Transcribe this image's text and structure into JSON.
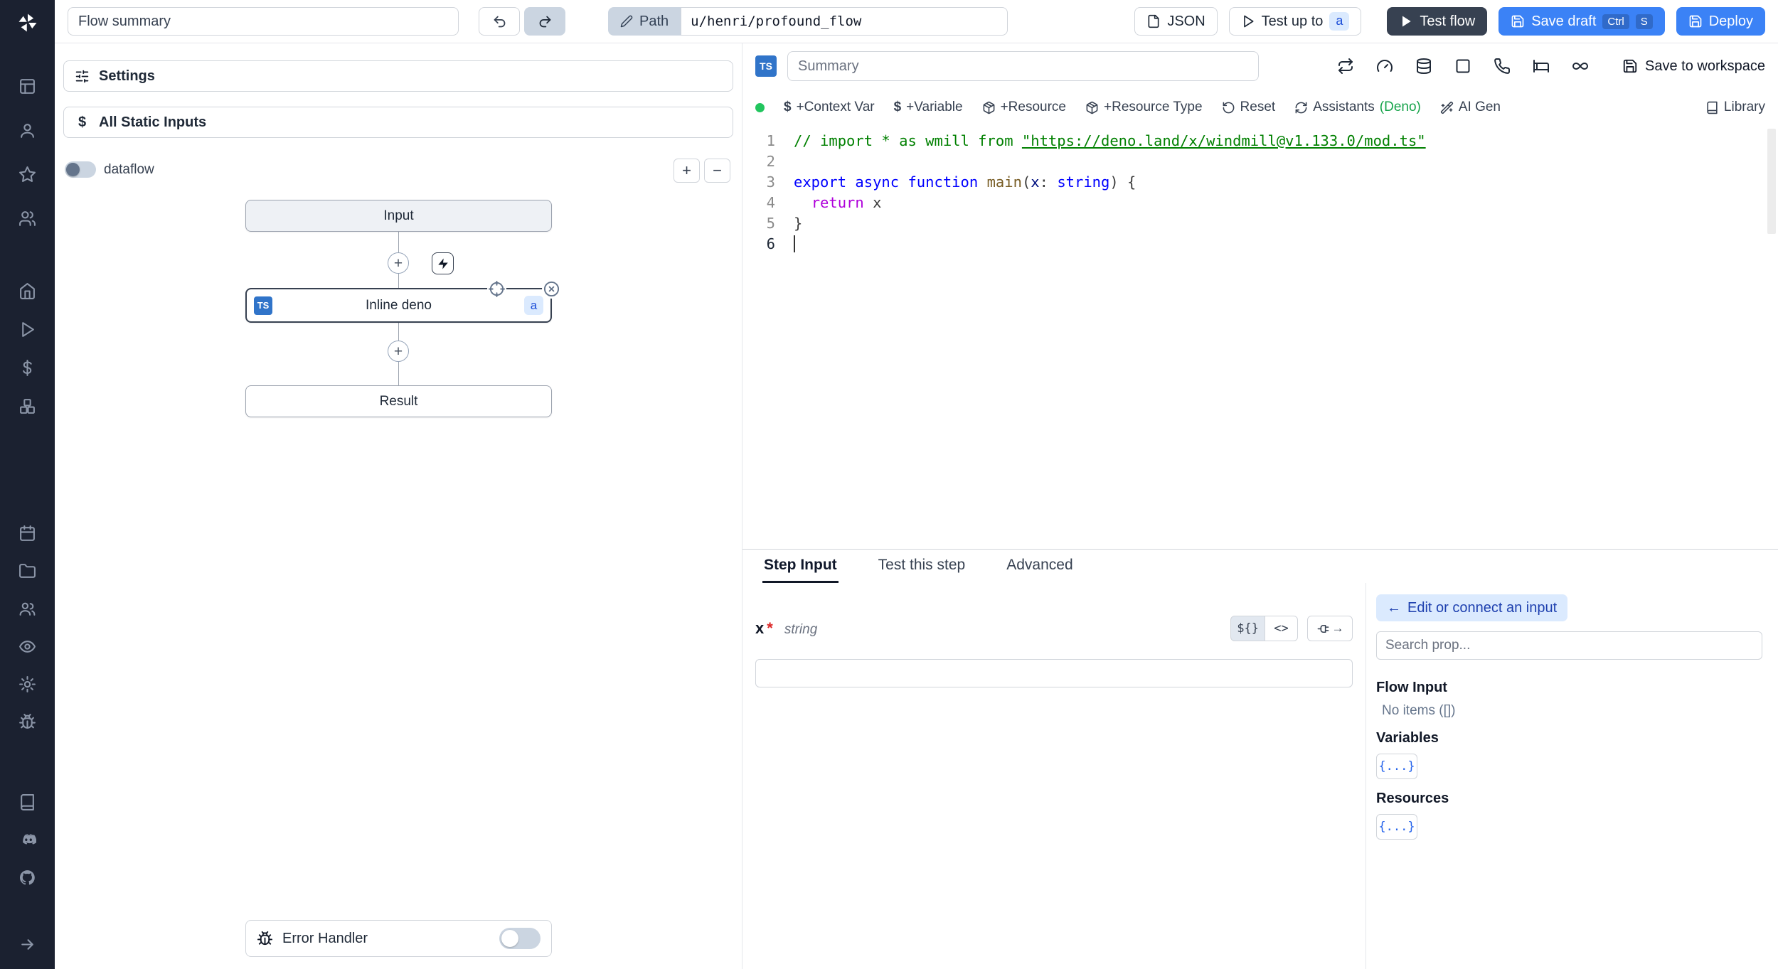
{
  "colors": {
    "sidebar_bg": "#1b2130",
    "accent_blue": "#3b82f6",
    "dark_button": "#374151",
    "status_green": "#22c55e",
    "badge_bg": "#dbeafe",
    "badge_text": "#1d4ed8"
  },
  "sidebar": {
    "icon_names": [
      "windmill-logo",
      "apps-grid",
      "user",
      "star",
      "users",
      "home",
      "play",
      "dollar",
      "boxes",
      "calendar",
      "folder",
      "group",
      "eye",
      "gear",
      "bug",
      "book",
      "discord",
      "github",
      "arrow-right"
    ]
  },
  "topbar": {
    "flow_summary_value": "Flow summary",
    "path_label": "Path",
    "path_value": "u/henri/profound_flow",
    "json_button": "JSON",
    "test_up_to_label": "Test up to",
    "test_up_to_badge": "a",
    "test_flow_label": "Test flow",
    "save_draft_label": "Save draft",
    "save_draft_kbd": [
      "Ctrl",
      "S"
    ],
    "deploy_label": "Deploy"
  },
  "flow_panel": {
    "settings_label": "Settings",
    "static_inputs_glyph": "$",
    "all_static_inputs_label": "All Static Inputs",
    "dataflow_label": "dataflow",
    "zoom_in_label": "+",
    "zoom_out_label": "−",
    "input_node_label": "Input",
    "inline_node_label": "Inline deno",
    "inline_node_lang": "TS",
    "inline_node_badge": "a",
    "result_node_label": "Result",
    "error_handler_label": "Error Handler"
  },
  "editor": {
    "lang_badge": "TS",
    "summary_placeholder": "Summary",
    "save_to_workspace_label": "Save to workspace",
    "library_label": "Library",
    "toolbar": [
      {
        "icon_glyph": "$",
        "label": "+Context Var"
      },
      {
        "icon_glyph": "$",
        "label": "+Variable"
      },
      {
        "label": "+Resource"
      },
      {
        "label": "+Resource Type"
      },
      {
        "label": "Reset"
      },
      {
        "label": "Assistants",
        "suffix": "(Deno)"
      },
      {
        "label": "AI Gen"
      }
    ],
    "code_lines": [
      {
        "n": "1",
        "tokens": [
          {
            "c": "comment",
            "t": "// import * as wmill from "
          },
          {
            "c": "comment link",
            "t": "\"https://deno.land/x/windmill@v1.133.0/mod.ts\""
          }
        ]
      },
      {
        "n": "2",
        "tokens": []
      },
      {
        "n": "3",
        "tokens": [
          {
            "c": "kw",
            "t": "export"
          },
          {
            "c": "",
            "t": " "
          },
          {
            "c": "kw",
            "t": "async"
          },
          {
            "c": "",
            "t": " "
          },
          {
            "c": "kw",
            "t": "function"
          },
          {
            "c": "",
            "t": " "
          },
          {
            "c": "fn",
            "t": "main"
          },
          {
            "c": "",
            "t": "("
          },
          {
            "c": "param",
            "t": "x"
          },
          {
            "c": "",
            "t": ": "
          },
          {
            "c": "kw",
            "t": "string"
          },
          {
            "c": "",
            "t": ") {"
          }
        ]
      },
      {
        "n": "4",
        "tokens": [
          {
            "c": "",
            "t": "  "
          },
          {
            "c": "ctrl",
            "t": "return"
          },
          {
            "c": "",
            "t": " x"
          }
        ]
      },
      {
        "n": "5",
        "tokens": [
          {
            "c": "",
            "t": "}"
          }
        ]
      },
      {
        "n": "6",
        "cursor": true,
        "tokens": []
      }
    ]
  },
  "step_panel": {
    "tabs": [
      "Step Input",
      "Test this step",
      "Advanced"
    ],
    "arg_name": "x",
    "arg_required_mark": "*",
    "arg_type": "string",
    "template_btn_label": "${}",
    "code_btn_label": "<>",
    "plug_arrow": "→",
    "connect": {
      "back_arrow": "←",
      "edit_button_label": "Edit or connect an input",
      "search_placeholder": "Search prop...",
      "flow_input_title": "Flow Input",
      "flow_input_empty": "No items ([])",
      "variables_title": "Variables",
      "variables_button": "{...}",
      "resources_title": "Resources",
      "resources_button": "{...}"
    }
  }
}
